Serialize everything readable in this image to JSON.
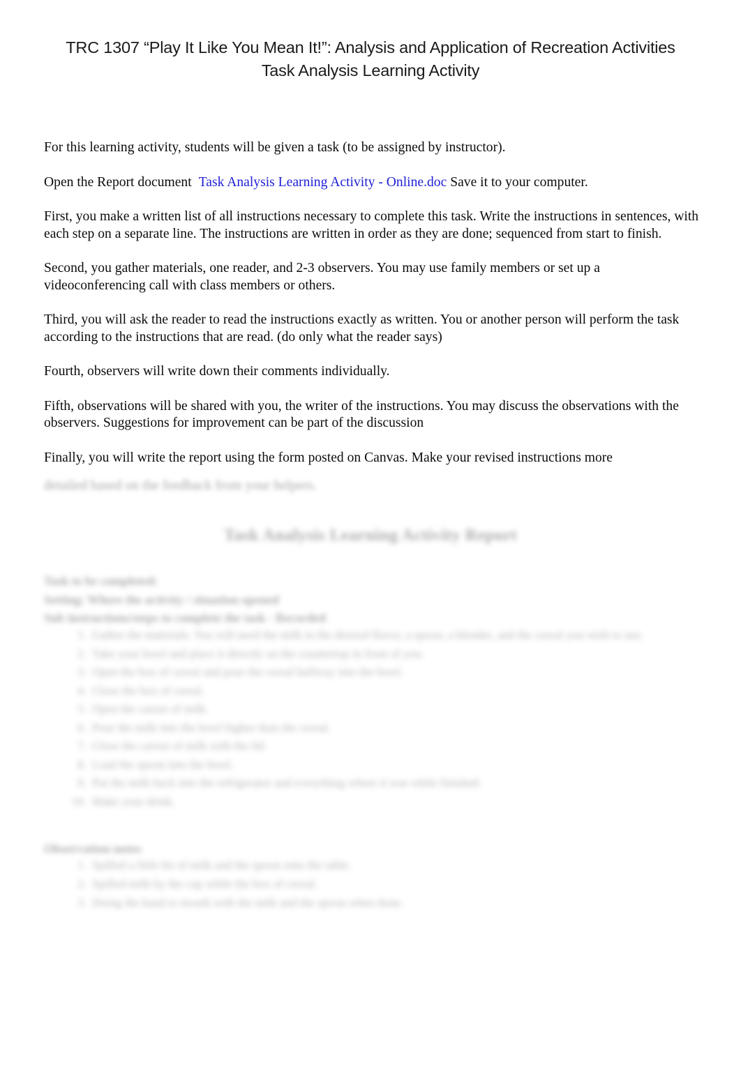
{
  "document": {
    "title_line_1": "TRC 1307 “Play It Like You Mean It!”:  Analysis and Application of Recreation Activities",
    "title_line_2": "Task Analysis Learning Activity",
    "link_color": "#1f1fd6",
    "page_background": "#ffffff",
    "text_color": "#000000"
  },
  "body": {
    "paragraph_1": "For this learning activity, students will be given a task (to be assigned by instructor).",
    "paragraph_2_prefix": "Open the Report document",
    "paragraph_2_link": "Task Analysis Learning Activity - Online.doc",
    "paragraph_2_suffix": "Save it to your computer.",
    "paragraph_3": "First, you make a written list of all instructions necessary to complete this task. Write the instructions in sentences, with each step on a separate line. The instructions are written in order as they are done; sequenced from start to finish.",
    "paragraph_4": "Second, you gather materials, one reader, and 2-3 observers. You may use family members or set up a videoconferencing call with class members or others.",
    "paragraph_5": "Third, you will ask the reader to read the instructions exactly as written. You or another person will perform the task according to the instructions that are read. (do only what the reader says)",
    "paragraph_6": "Fourth, observers will write down their comments individually.",
    "paragraph_7": "Fifth, observations will be shared with you, the writer of the instructions. You may discuss the observations with the observers. Suggestions for improvement can be part of the discussion",
    "paragraph_8": "Finally, you will write the report using the form posted on Canvas. Make your revised instructions more"
  },
  "report": {
    "tail_line": "detailed based on the feedback from your helpers.",
    "heading": "Task Analysis Learning Activity Report",
    "fields": [
      "Task to be completed:",
      "Setting: Where the activity / situation opened",
      "Sub instructions/steps to complete the task - Recorded"
    ],
    "steps": [
      "Gather the materials. You will need the milk in the desired flavor, a spoon, a blender, and the cereal you wish to use.",
      "Take your bowl and place it directly on the countertop in front of you.",
      "Open the box of cereal and pour the cereal halfway into the bowl.",
      "Close the box of cereal.",
      "Open the carton of milk.",
      "Pour the milk into the bowl higher than the cereal.",
      "Close the carton of milk with the lid.",
      "Load the spoon into the bowl.",
      "Put the milk back into the refrigerator and everything where it was while finished.",
      "Make your drink."
    ],
    "observation_heading": "Observation notes",
    "observations": [
      "Spilled a little bit of milk and the spoon onto the table.",
      "Spilled milk by the cup while the box of cereal.",
      "Doing the hand to mouth with the milk and the spoon when done."
    ]
  }
}
